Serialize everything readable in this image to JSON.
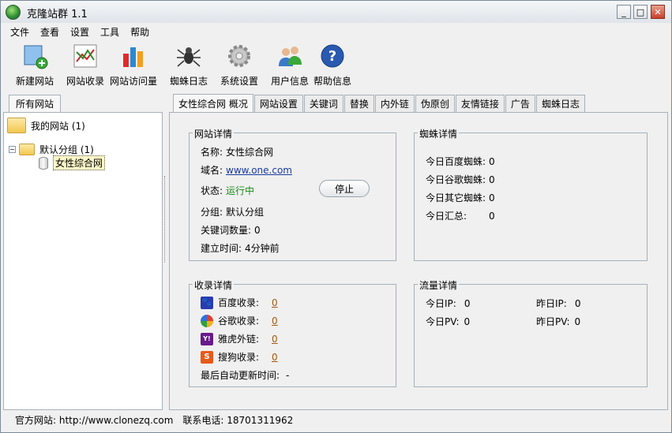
{
  "window": {
    "title": "克隆站群 1.1",
    "minimize": "_",
    "maximize": "□",
    "close": "✕"
  },
  "menu": [
    "文件",
    "查看",
    "设置",
    "工具",
    "帮助"
  ],
  "toolbar": [
    {
      "label": "新建网站",
      "icon": "new-site-icon"
    },
    {
      "label": "网站收录",
      "icon": "site-index-chart-icon"
    },
    {
      "label": "网站访问量",
      "icon": "traffic-bar-chart-icon"
    },
    {
      "label": "蜘蛛日志",
      "icon": "spider-icon"
    },
    {
      "label": "系统设置",
      "icon": "gear-icon"
    },
    {
      "label": "用户信息",
      "icon": "users-icon"
    },
    {
      "label": "帮助信息",
      "icon": "help-icon"
    }
  ],
  "left": {
    "tab": "所有网站",
    "tree": {
      "root": "我的网站 (1)",
      "group": "默认分组 (1)",
      "site": "女性综合网"
    }
  },
  "tabs": [
    "女性综合网 概况",
    "网站设置",
    "关键词",
    "替换",
    "内外链",
    "伪原创",
    "友情链接",
    "广告",
    "蜘蛛日志"
  ],
  "site_details": {
    "title": "网站详情",
    "name_label": "名称:",
    "name": "女性综合网",
    "domain_label": "域名:",
    "domain": "www.one.com",
    "status_label": "状态:",
    "status": "运行中",
    "stop_button": "停止",
    "group_label": "分组:",
    "group": "默认分组",
    "keywords_label": "关键词数量:",
    "keywords": "0",
    "created_label": "建立时间:",
    "created": "4分钟前"
  },
  "spider_details": {
    "title": "蜘蛛详情",
    "rows": [
      {
        "label": "今日百度蜘蛛:",
        "value": "0"
      },
      {
        "label": "今日谷歌蜘蛛:",
        "value": "0"
      },
      {
        "label": "今日其它蜘蛛:",
        "value": "0"
      },
      {
        "label": "今日汇总:",
        "value": "0"
      }
    ]
  },
  "index_details": {
    "title": "收录详情",
    "rows": [
      {
        "label": "百度收录:",
        "value": "0",
        "icon": "baidu-icon",
        "color": "#2a3ab0",
        "glyph": "🐾"
      },
      {
        "label": "谷歌收录:",
        "value": "0",
        "icon": "google-icon",
        "color": "#e0a020",
        "glyph": "●"
      },
      {
        "label": "雅虎外链:",
        "value": "0",
        "icon": "yahoo-icon",
        "color": "#6a1a8a",
        "glyph": "Y!"
      },
      {
        "label": "搜狗收录:",
        "value": "0",
        "icon": "sogou-icon",
        "color": "#e85a1a",
        "glyph": "S"
      }
    ],
    "auto_update_label": "最后自动更新时间:",
    "auto_update_value": "-"
  },
  "traffic_details": {
    "title": "流量详情",
    "today_ip_label": "今日IP:",
    "today_ip": "0",
    "yesterday_ip_label": "昨日IP:",
    "yesterday_ip": "0",
    "today_pv_label": "今日PV:",
    "today_pv": "0",
    "yesterday_pv_label": "昨日PV:",
    "yesterday_pv": "0"
  },
  "statusbar": {
    "site": "官方网站: http://www.clonezq.com",
    "phone": "联系电话: 18701311962"
  }
}
